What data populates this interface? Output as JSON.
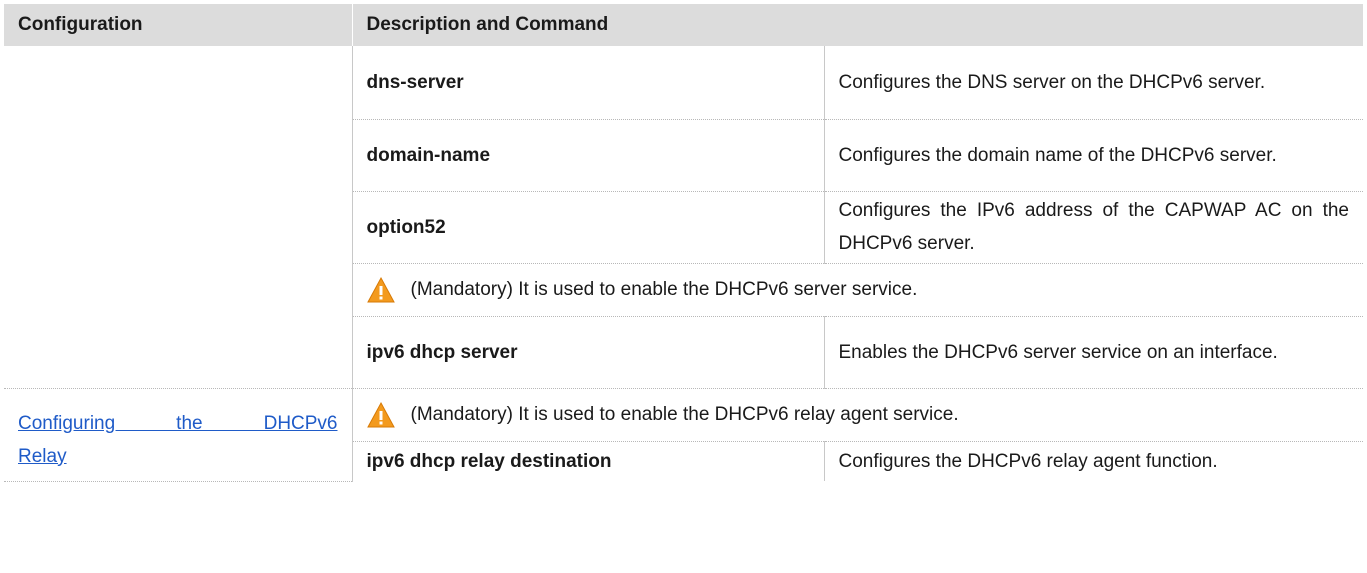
{
  "header": {
    "configuration": "Configuration",
    "description_and_command": "Description and Command"
  },
  "rows": [
    {
      "command": "dns-server",
      "description": "Configures the DNS server on the DHCPv6 server."
    },
    {
      "command": "domain-name",
      "description": "Configures the domain name of the DHCPv6 server."
    },
    {
      "command": "option52",
      "description": "Configures the IPv6 address of the CAPWAP AC on the DHCPv6 server."
    }
  ],
  "server_note": "(Mandatory) It is used to enable the DHCPv6 server service.",
  "server_row": {
    "command": "ipv6 dhcp server",
    "description": "Enables the DHCPv6 server service on an interface."
  },
  "relay": {
    "link_line1": "Configuring the DHCPv6",
    "link_line2": "Relay",
    "note": "(Mandatory) It is used to enable the DHCPv6 relay agent service.",
    "command": "ipv6 dhcp relay destination",
    "description": "Configures the DHCPv6 relay agent function."
  },
  "icons": {
    "warning": "warning-triangle-icon",
    "warning_color": "#f39a1e"
  }
}
